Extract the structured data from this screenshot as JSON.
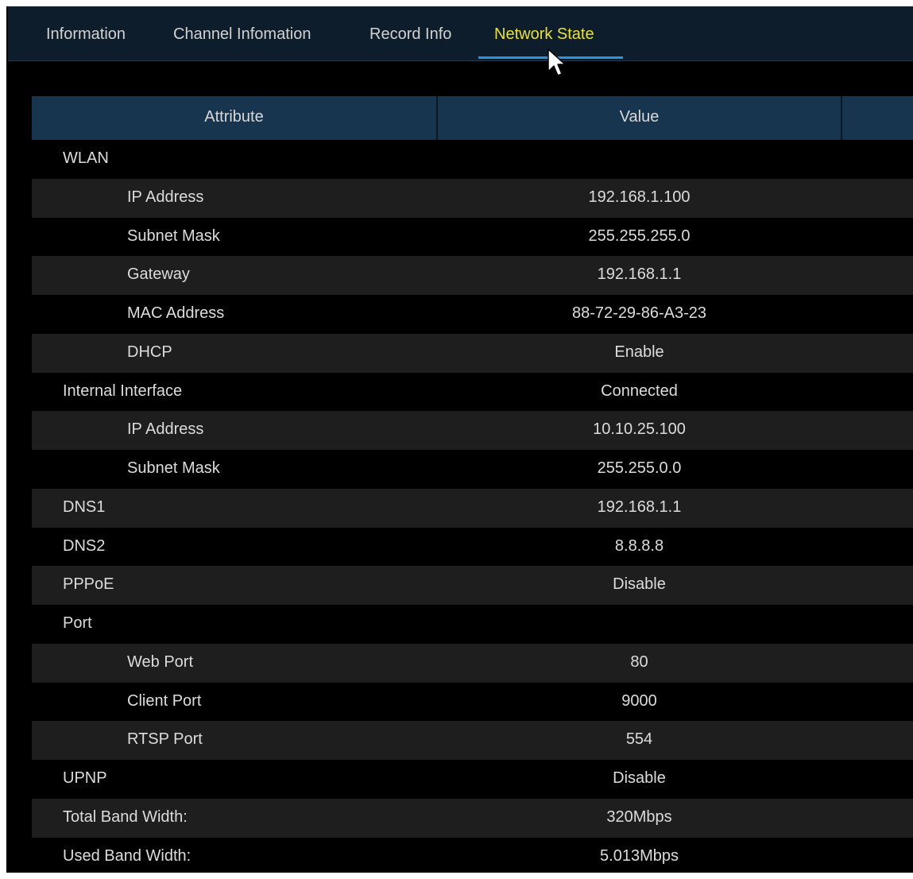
{
  "tabs": [
    {
      "label": "Information",
      "active": false
    },
    {
      "label": "Channel Infomation",
      "active": false
    },
    {
      "label": "Record Info",
      "active": false
    },
    {
      "label": "Network State",
      "active": true
    }
  ],
  "table": {
    "columns": [
      "Attribute",
      "Value",
      ""
    ],
    "rows": [
      {
        "attribute": "WLAN",
        "value": "",
        "level": 0
      },
      {
        "attribute": "IP Address",
        "value": "192.168.1.100",
        "level": 1
      },
      {
        "attribute": "Subnet Mask",
        "value": "255.255.255.0",
        "level": 1
      },
      {
        "attribute": "Gateway",
        "value": "192.168.1.1",
        "level": 1
      },
      {
        "attribute": "MAC Address",
        "value": "88-72-29-86-A3-23",
        "level": 1
      },
      {
        "attribute": "DHCP",
        "value": "Enable",
        "level": 1
      },
      {
        "attribute": "Internal Interface",
        "value": "Connected",
        "level": 0
      },
      {
        "attribute": "IP Address",
        "value": "10.10.25.100",
        "level": 1
      },
      {
        "attribute": "Subnet Mask",
        "value": "255.255.0.0",
        "level": 1
      },
      {
        "attribute": "DNS1",
        "value": "192.168.1.1",
        "level": 0
      },
      {
        "attribute": "DNS2",
        "value": "8.8.8.8",
        "level": 0
      },
      {
        "attribute": "PPPoE",
        "value": "Disable",
        "level": 0
      },
      {
        "attribute": "Port",
        "value": "",
        "level": 0
      },
      {
        "attribute": "Web Port",
        "value": "80",
        "level": 1
      },
      {
        "attribute": "Client Port",
        "value": "9000",
        "level": 1
      },
      {
        "attribute": "RTSP Port",
        "value": "554",
        "level": 1
      },
      {
        "attribute": "UPNP",
        "value": "Disable",
        "level": 0
      },
      {
        "attribute": "Total Band Width:",
        "value": "320Mbps",
        "level": 0
      },
      {
        "attribute": "Used Band Width:",
        "value": "5.013Mbps",
        "level": 0
      }
    ]
  },
  "colors": {
    "tab_bar_bg": "#0e1d2c",
    "active_tab_text": "#e8e32a",
    "tab_underline": "#2b93e0",
    "header_bg": "#17354f",
    "row_alt_bg": "#1e1e1e",
    "row_bg": "#000000"
  },
  "icons": {
    "pointer": "arrow-cursor-icon"
  }
}
